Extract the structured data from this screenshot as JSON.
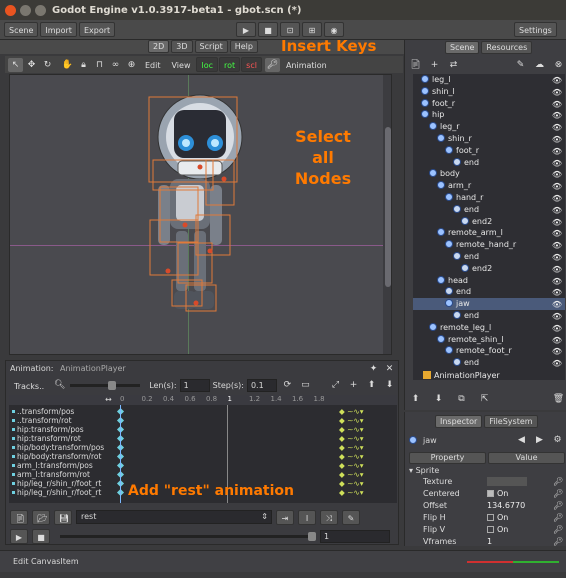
{
  "window_title": "Godot Engine v1.0.3917-beta1 - gbot.scn (*)",
  "menu": {
    "scene": "Scene",
    "import": "Import",
    "export": "Export",
    "settings": "Settings"
  },
  "modes": {
    "d2": "2D",
    "d3": "3D",
    "script": "Script",
    "help": "Help"
  },
  "scene_tabs": {
    "scene": "Scene",
    "resources": "Resources"
  },
  "toolbar": {
    "edit": "Edit",
    "view": "View",
    "loc": "loc",
    "rot": "rot",
    "scl": "scl",
    "animation": "Animation"
  },
  "annotations": {
    "insert_keys": "Insert Keys",
    "select_all_1": "Select",
    "select_all_2": "all",
    "select_all_3": "Nodes",
    "add_rest": "Add \"rest\" animation"
  },
  "scene_tree": [
    {
      "label": "leg_l",
      "indent": 0
    },
    {
      "label": "shin_l",
      "indent": 0
    },
    {
      "label": "foot_r",
      "indent": 0
    },
    {
      "label": "hip",
      "indent": 0
    },
    {
      "label": "leg_r",
      "indent": 1
    },
    {
      "label": "shin_r",
      "indent": 2
    },
    {
      "label": "foot_r",
      "indent": 3
    },
    {
      "label": "end",
      "indent": 4
    },
    {
      "label": "body",
      "indent": 1
    },
    {
      "label": "arm_r",
      "indent": 2
    },
    {
      "label": "hand_r",
      "indent": 3
    },
    {
      "label": "end",
      "indent": 4
    },
    {
      "label": "end2",
      "indent": 5
    },
    {
      "label": "remote_arm_l",
      "indent": 2
    },
    {
      "label": "remote_hand_r",
      "indent": 3
    },
    {
      "label": "end",
      "indent": 4
    },
    {
      "label": "end2",
      "indent": 5
    },
    {
      "label": "head",
      "indent": 2
    },
    {
      "label": "end",
      "indent": 3
    },
    {
      "label": "jaw",
      "indent": 3
    },
    {
      "label": "end",
      "indent": 4
    },
    {
      "label": "remote_leg_l",
      "indent": 1
    },
    {
      "label": "remote_shin_l",
      "indent": 2
    },
    {
      "label": "remote_foot_r",
      "indent": 3
    },
    {
      "label": "end",
      "indent": 4
    }
  ],
  "animation_player_node": "AnimationPlayer",
  "anim_panel": {
    "title": "Animation:",
    "subtitle": "AnimationPlayer",
    "tracks": "Tracks..",
    "len_label": "Len(s):",
    "len_value": "1",
    "step_label": "Step(s):",
    "step_value": "0.1",
    "ruler": [
      "0",
      "0.2",
      "0.4",
      "0.6",
      "0.8",
      "1",
      "1.2",
      "1.4",
      "1.6",
      "1.8"
    ],
    "tracks_list": [
      "..transform/pos",
      "..transform/rot",
      "hip:transform/pos",
      "hip:transform/rot",
      "hip/body:transform/pos",
      "hip/body:transform/rot",
      "arm_l:transform/pos",
      "arm_l:transform/rot",
      "hip/leg_r/shin_r/foot_rt",
      "hip/leg_r/shin_r/foot_rt"
    ],
    "anim_name": "rest",
    "speed": "1"
  },
  "inspector_tabs": {
    "inspector": "Inspector",
    "filesystem": "FileSystem"
  },
  "inspector": {
    "node": "jaw",
    "col_property": "Property",
    "col_value": "Value",
    "section": "Sprite",
    "props": [
      {
        "k": "Texture",
        "v": ""
      },
      {
        "k": "Centered",
        "v": "On"
      },
      {
        "k": "Offset",
        "v": "134.6770"
      },
      {
        "k": "Flip H",
        "v": "On"
      },
      {
        "k": "Flip V",
        "v": "On"
      },
      {
        "k": "Vframes",
        "v": "1"
      }
    ]
  },
  "status": "Edit CanvasItem"
}
